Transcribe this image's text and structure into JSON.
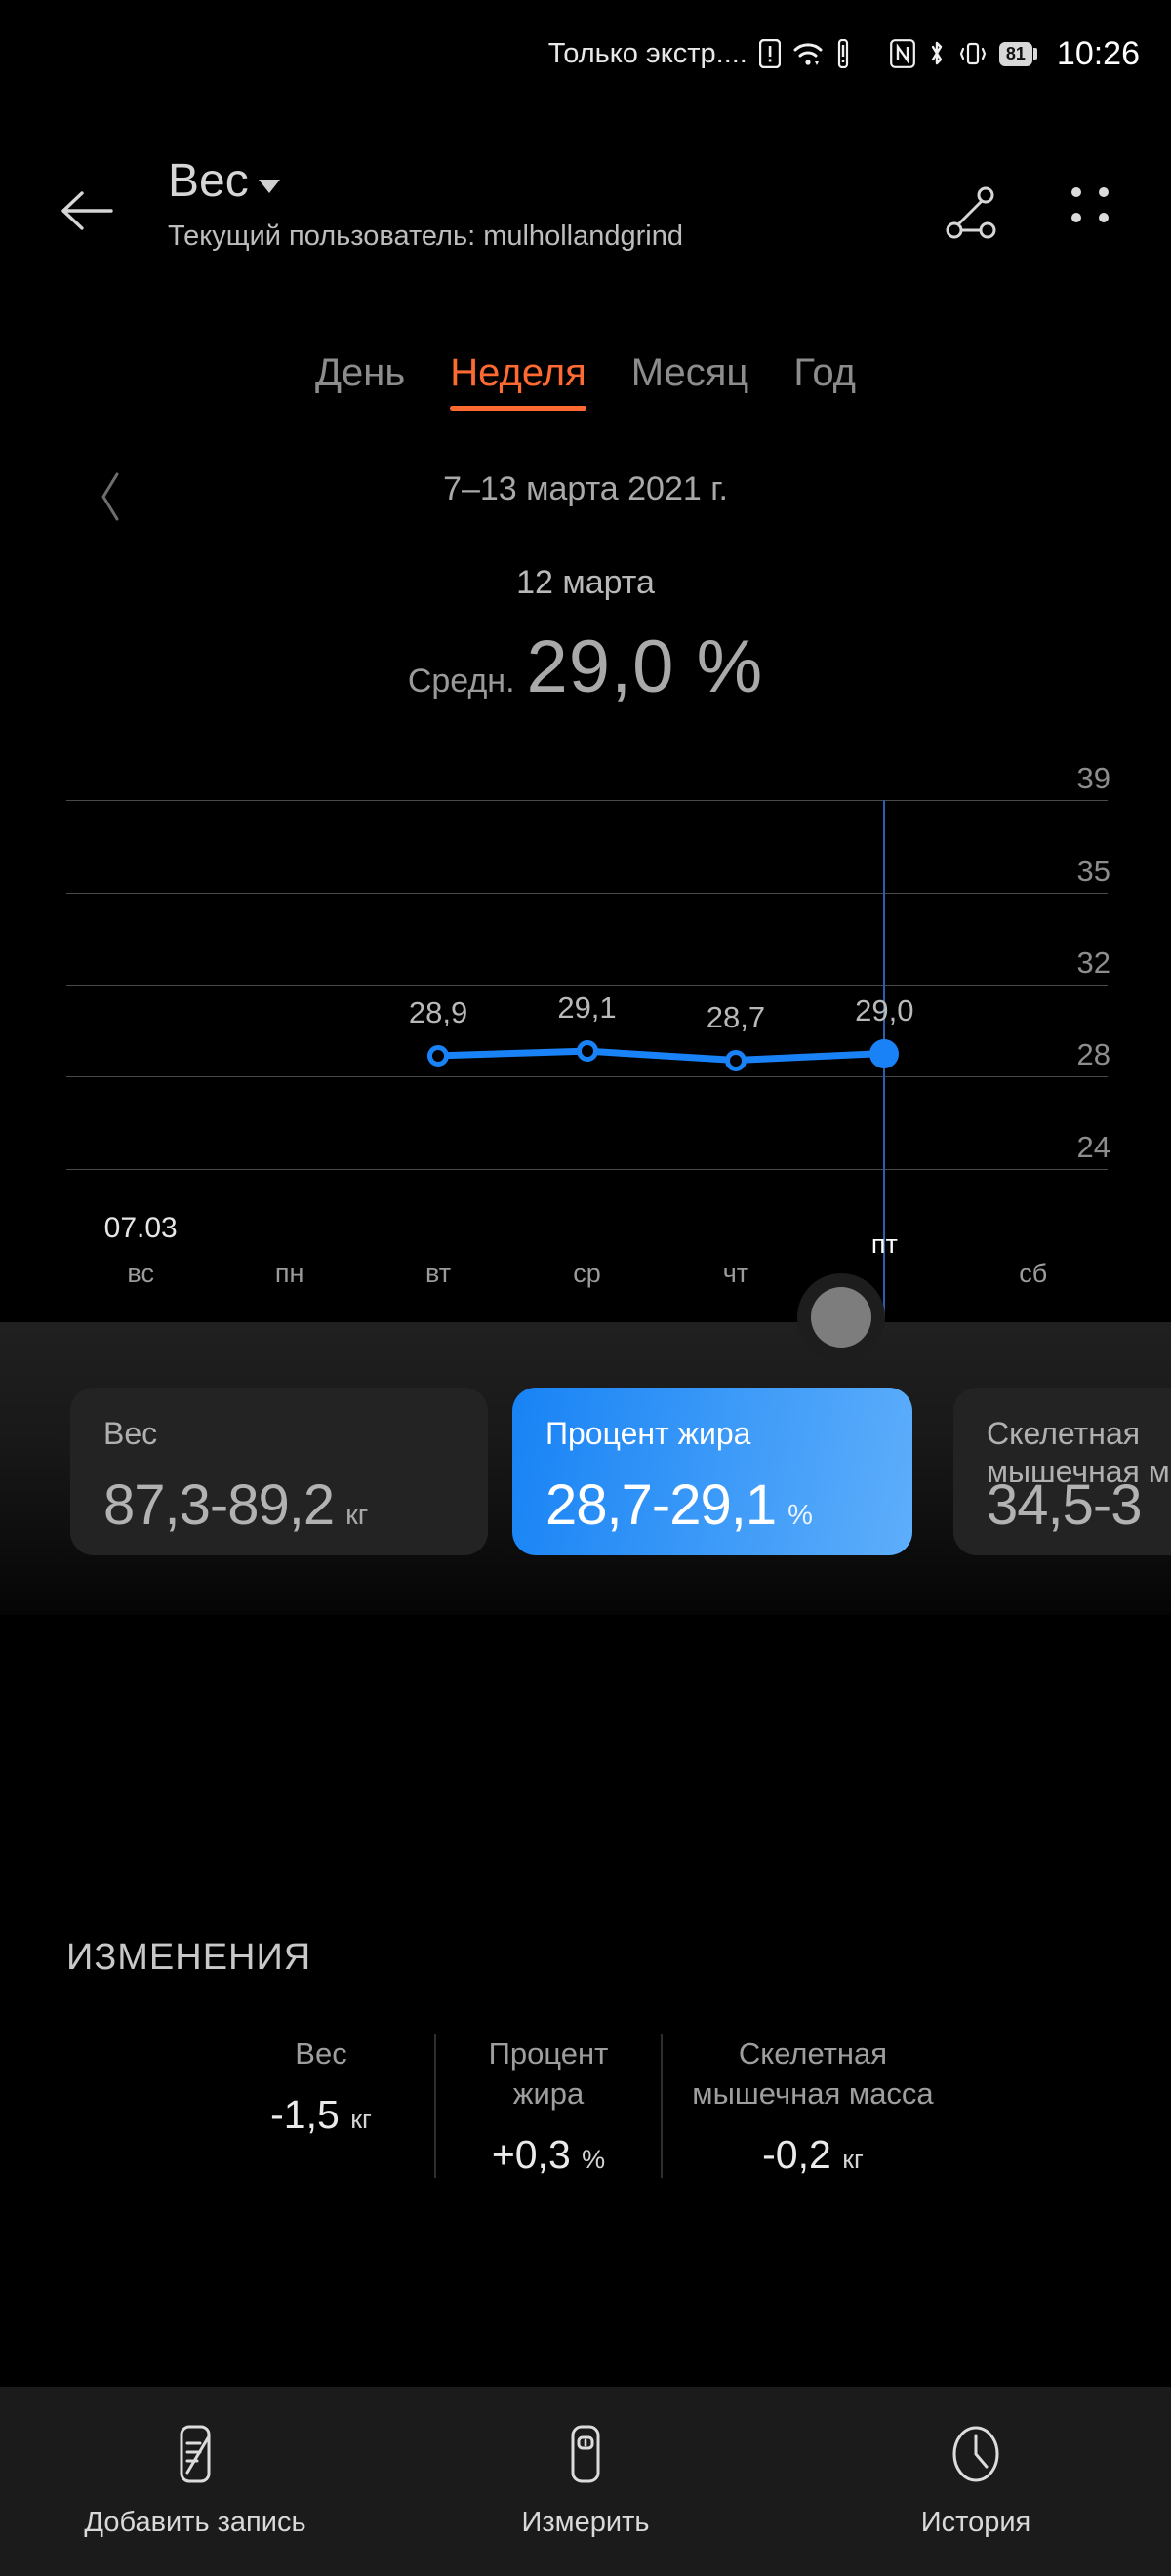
{
  "status_bar": {
    "carrier": "Только экстр....",
    "icons": [
      "sim-alert-icon",
      "wifi-icon",
      "signal-alert-icon",
      "nfc-icon",
      "bluetooth-icon",
      "vibrate-icon"
    ],
    "battery_percent": "81",
    "time": "10:26"
  },
  "app_bar": {
    "back_icon": "back-arrow-icon",
    "title": "Вес",
    "dropdown_icon": "chevron-down-icon",
    "subtitle": "Текущий пользователь: mulhollandgrind",
    "share_icon": "share-icon",
    "more_icon": "more-options-icon"
  },
  "tabs": [
    {
      "label": "День",
      "active": false
    },
    {
      "label": "Неделя",
      "active": true
    },
    {
      "label": "Месяц",
      "active": false
    },
    {
      "label": "Год",
      "active": false
    }
  ],
  "range": {
    "prev_icon": "chevron-left-icon",
    "text": "7–13 марта 2021 г.",
    "selected_day": "12 марта"
  },
  "average": {
    "label": "Средн.",
    "value": "29,0 %"
  },
  "chart_data": {
    "type": "line",
    "title": "Процент жира",
    "xlabel": "",
    "ylabel": "",
    "ylim": [
      22,
      41
    ],
    "yticks": [
      "39",
      "35",
      "32",
      "28",
      "24"
    ],
    "ytick_values": [
      39,
      35,
      32,
      28,
      24
    ],
    "grid": true,
    "legend": "none",
    "categories": [
      "вс",
      "пн",
      "вт",
      "ср",
      "чт",
      "пт",
      "сб"
    ],
    "x_start_date": "07.03",
    "selected_category": "пт",
    "series": [
      {
        "name": "Процент жира",
        "color": "#1A82F7",
        "points": [
          {
            "category": "вт",
            "value": 28.9,
            "label": "28,9",
            "selected": false
          },
          {
            "category": "ср",
            "value": 29.1,
            "label": "29,1",
            "selected": false
          },
          {
            "category": "чт",
            "value": 28.7,
            "label": "28,7",
            "selected": false
          },
          {
            "category": "пт",
            "value": 29.0,
            "label": "29,0",
            "selected": true
          }
        ]
      }
    ]
  },
  "metric_cards": [
    {
      "label": "Вес",
      "value": "87,3-89,2",
      "unit": "кг",
      "selected": false
    },
    {
      "label": "Процент жира",
      "value": "28,7-29,1",
      "unit": "%",
      "selected": true
    },
    {
      "label": "Скелетная мышечная масса",
      "value": "34,5-3",
      "unit": "",
      "selected": false
    }
  ],
  "changes": {
    "title": "ИЗМЕНЕНИЯ",
    "items": [
      {
        "label": "Вес",
        "value": "-1,5",
        "unit": "кг"
      },
      {
        "label": "Процент жира",
        "value": "+0,3",
        "unit": "%"
      },
      {
        "label": "Скелетная мышечная масса",
        "value": "-0,2",
        "unit": "кг"
      }
    ]
  },
  "bottom_bar": [
    {
      "label": "Добавить запись",
      "icon": "add-record-icon"
    },
    {
      "label": "Измерить",
      "icon": "scale-icon"
    },
    {
      "label": "История",
      "icon": "history-clock-icon"
    }
  ],
  "colors": {
    "accent_orange": "#FF6A33",
    "accent_blue": "#1A82F7",
    "background": "#000000",
    "panel": "#1D1D1D"
  }
}
